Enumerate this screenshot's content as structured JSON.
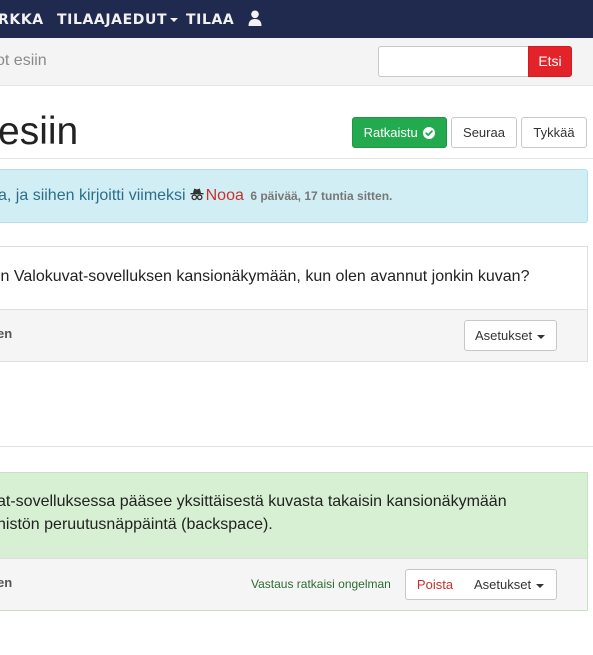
{
  "navbar": {
    "items": [
      {
        "label": "RKKA"
      },
      {
        "label": "TILAAJAEDUT"
      },
      {
        "label": "TILAA"
      }
    ],
    "icons": {
      "user": "user-icon",
      "dropdown": "caret-down-icon"
    },
    "colors": {
      "background": "#1f2a4e"
    }
  },
  "search": {
    "breadcrumb": "ot esiin",
    "value": "",
    "placeholder": "",
    "button_label": "Etsi",
    "icon": "search-icon"
  },
  "question": {
    "title": "esiin",
    "actions": {
      "solved_label": "Ratkaistu",
      "solved_icon": "check-circle-icon",
      "follow_label": "Seuraa",
      "like_label": "Tykkää"
    },
    "colors": {
      "solved": "#23a94e"
    }
  },
  "info_alert": {
    "text_prefix": "a, ja siihen kirjoitti viimeksi",
    "author": "Nooa",
    "author_icon": "incognito-icon",
    "time_ago": "6 päivää, 17 tuntia sitten."
  },
  "posts": [
    {
      "body_lines": [
        "in Valokuvat-sovelluksen kansionäkymään, kun olen avannut jonkin kuvan?"
      ],
      "footer_fragment": "en",
      "settings_label": "Asetukset"
    },
    {
      "body_lines": [
        "at-sovelluksessa pääsee yksittäisestä kuvasta takaisin kansionäkymään",
        "histön peruutusnäppäintä (backspace)."
      ],
      "footer_fragment": "en",
      "solved_note": "Vastaus ratkaisi ongelman",
      "delete_label": "Poista",
      "settings_label": "Asetukset",
      "colors": {
        "background": "#d7efd2"
      }
    }
  ]
}
